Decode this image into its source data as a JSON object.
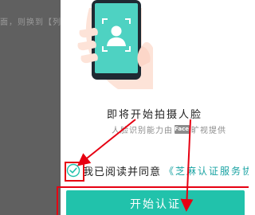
{
  "background": {
    "text": "面，则换到【列"
  },
  "dialog": {
    "title": "即将开始拍摄人脸",
    "provider_prefix": "人脸识别能力由",
    "provider_logo": "Face⁺⁺",
    "provider_suffix": "旷视提供",
    "agree_text": "我已阅读并同意",
    "agreement_link": "《芝麻认证服务协",
    "start_button": "开始认证",
    "checkbox_checked": true
  },
  "annotations": {
    "color": "#e60012",
    "accent": "#21c2ab"
  },
  "icons": [
    "phone-face-scan-illustration",
    "check-circle-icon"
  ]
}
